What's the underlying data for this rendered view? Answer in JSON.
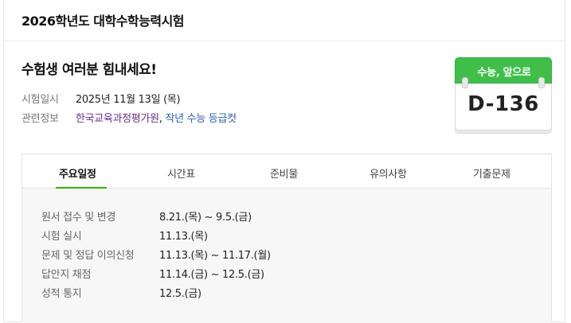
{
  "header": {
    "title": "2026학년도 대학수학능력시험"
  },
  "headline": "수험생 여러분 힘내세요!",
  "info": {
    "date_label": "시험일시",
    "date_value": "2025년 11월 13일 (목)",
    "related_label": "관련정보",
    "link1": "한국교육과정평가원",
    "separator": ",",
    "link2": "작년 수능 등급컷"
  },
  "dday": {
    "label": "수능, 앞으로",
    "count": "D-136"
  },
  "tabs": [
    "주요일정",
    "시간표",
    "준비물",
    "유의사항",
    "기출문제"
  ],
  "active_tab": "주요일정",
  "schedule": [
    {
      "item": "원서 접수 및 변경",
      "date": "8.21.(목) ~ 9.5.(금)"
    },
    {
      "item": "시험 실시",
      "date": "11.13.(목)"
    },
    {
      "item": "문제 및 정답 이의신청",
      "date": "11.13.(목) ~ 11.17.(월)"
    },
    {
      "item": "답안지 채점",
      "date": "11.14.(금) ~ 12.5.(금)"
    },
    {
      "item": "성적 통지",
      "date": "12.5.(금)"
    }
  ],
  "colors": {
    "accent_green": "#3fbf4a",
    "tab_underline": "#2db400",
    "link_purple": "#6a2d8c",
    "link_blue": "#2a5db0"
  }
}
